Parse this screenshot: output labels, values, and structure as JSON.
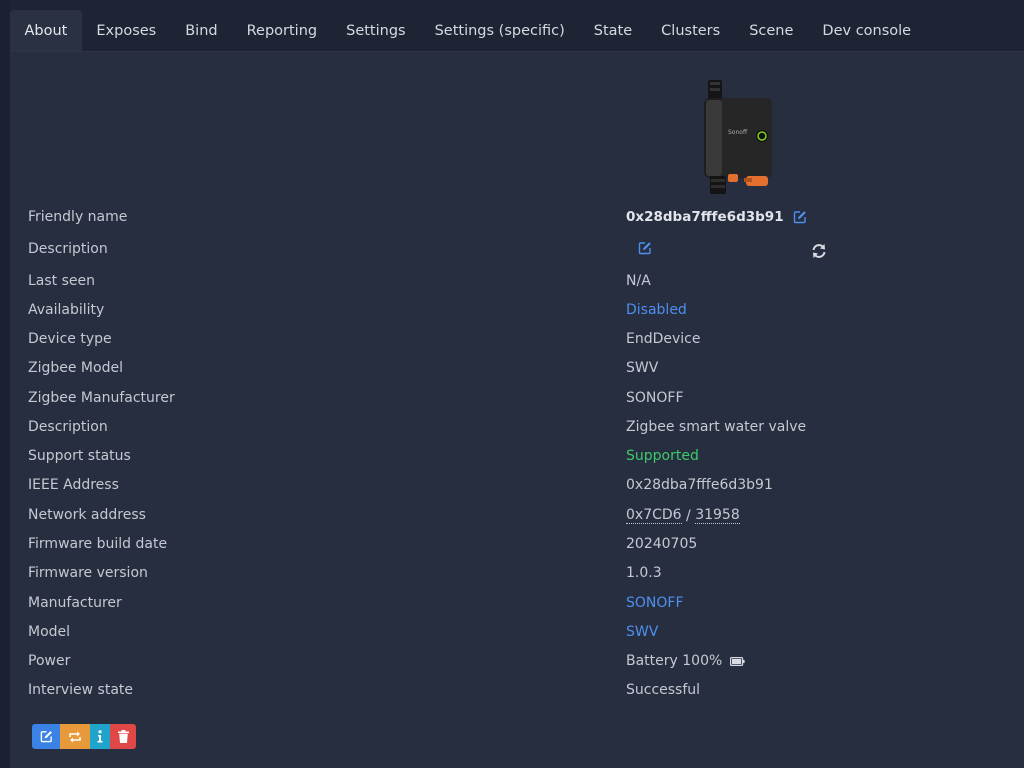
{
  "tabs": [
    {
      "label": "About",
      "active": true
    },
    {
      "label": "Exposes"
    },
    {
      "label": "Bind"
    },
    {
      "label": "Reporting"
    },
    {
      "label": "Settings"
    },
    {
      "label": "Settings (specific)"
    },
    {
      "label": "State"
    },
    {
      "label": "Clusters"
    },
    {
      "label": "Scene"
    },
    {
      "label": "Dev console"
    }
  ],
  "device": {
    "friendly_name_label": "Friendly name",
    "friendly_name": "0x28dba7fffe6d3b91",
    "description_label": "Description",
    "description": "",
    "last_seen_label": "Last seen",
    "last_seen": "N/A",
    "availability_label": "Availability",
    "availability": "Disabled",
    "device_type_label": "Device type",
    "device_type": "EndDevice",
    "zigbee_model_label": "Zigbee Model",
    "zigbee_model": "SWV",
    "zigbee_manufacturer_label": "Zigbee Manufacturer",
    "zigbee_manufacturer": "SONOFF",
    "model_description_label": "Description",
    "model_description": "Zigbee smart water valve",
    "support_status_label": "Support status",
    "support_status": "Supported",
    "ieee_address_label": "IEEE Address",
    "ieee_address": "0x28dba7fffe6d3b91",
    "network_address_label": "Network address",
    "network_address_hex": "0x7CD6",
    "network_address_sep": " / ",
    "network_address_dec": "31958",
    "firmware_build_date_label": "Firmware build date",
    "firmware_build_date": "20240705",
    "firmware_version_label": "Firmware version",
    "firmware_version": "1.0.3",
    "manufacturer_label": "Manufacturer",
    "manufacturer": "SONOFF",
    "model_label": "Model",
    "model": "SWV",
    "power_label": "Power",
    "power": "Battery 100%",
    "battery_level": 1.0,
    "interview_state_label": "Interview state",
    "interview_state": "Successful"
  },
  "icons": {
    "edit": "edit-icon",
    "refresh": "refresh-icon",
    "battery": "battery-full-icon",
    "rename": "rename-icon",
    "reconfigure": "reconfigure-icon",
    "info": "info-icon",
    "remove": "trash-icon"
  },
  "colors": {
    "link": "#4f8ff0",
    "success": "#3dc96a",
    "btn_edit": "#3b82e6",
    "btn_reconfigure": "#e89a3b",
    "btn_info": "#1fa4cc",
    "btn_remove": "#e04848"
  }
}
